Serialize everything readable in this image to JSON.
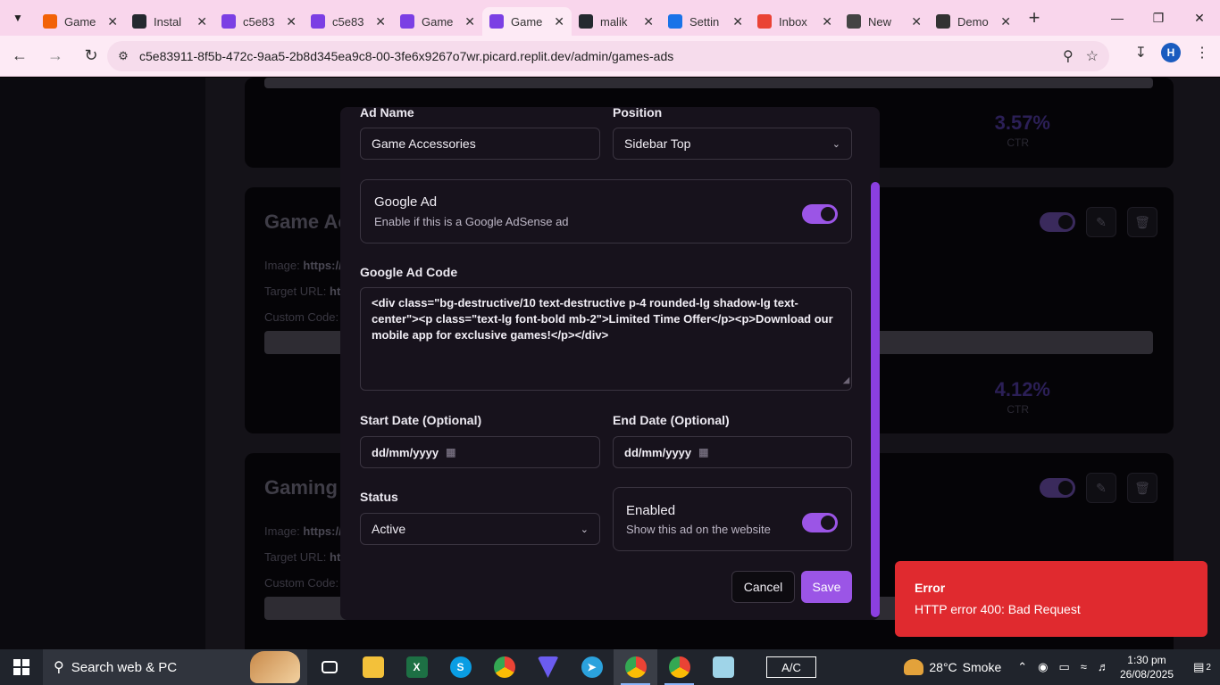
{
  "browser": {
    "tabs": [
      {
        "title": "Game",
        "favicon": "replit-icon",
        "color": "#f26207"
      },
      {
        "title": "Instal",
        "favicon": "github-icon",
        "color": "#24292f"
      },
      {
        "title": "c5e83",
        "favicon": "gamepad-icon",
        "color": "#7b3fe4"
      },
      {
        "title": "c5e83",
        "favicon": "gamepad-icon",
        "color": "#7b3fe4"
      },
      {
        "title": "Game",
        "favicon": "gamepad-icon",
        "color": "#7b3fe4"
      },
      {
        "title": "Game",
        "favicon": "gamepad-icon",
        "color": "#7b3fe4",
        "active": true
      },
      {
        "title": "malik",
        "favicon": "github-icon",
        "color": "#24292f"
      },
      {
        "title": "Settin",
        "favicon": "gear-icon",
        "color": "#1a73e8"
      },
      {
        "title": "Inbox",
        "favicon": "gmail-icon",
        "color": "#ea4335"
      },
      {
        "title": "New",
        "favicon": "chrome-icon",
        "color": "#444444"
      },
      {
        "title": "Demo",
        "favicon": "openai-icon",
        "color": "#333333"
      }
    ],
    "url": "c5e83911-8f5b-472c-9aa5-2b8d345ea9c8-00-3fe6x9267o7wr.picard.replit.dev/admin/games-ads",
    "profile_initial": "H"
  },
  "background_cards": [
    {
      "title": "",
      "ctr": "3.57%",
      "ctr_label": "CTR"
    },
    {
      "title": "Game Ac",
      "image_label": "Image:",
      "image_value": "https://i",
      "target_label": "Target URL:",
      "target_value": "htt",
      "custom_label": "Custom Code:",
      "ctr": "4.12%",
      "ctr_label": "CTR"
    },
    {
      "title": "Gaming (",
      "image_label": "Image:",
      "image_value": "https://i",
      "target_label": "Target URL:",
      "target_value": "htt",
      "custom_label": "Custom Code:"
    }
  ],
  "modal": {
    "ad_name_label": "Ad Name",
    "ad_name_value": "Game Accessories",
    "position_label": "Position",
    "position_value": "Sidebar Top",
    "google_ad_title": "Google Ad",
    "google_ad_desc": "Enable if this is a Google AdSense ad",
    "google_ad_enabled": true,
    "google_code_label": "Google Ad Code",
    "google_code_value": "<div class=\"bg-destructive/10 text-destructive p-4 rounded-lg shadow-lg text-center\"><p class=\"text-lg font-bold mb-2\">Limited Time Offer</p><p>Download our mobile app for exclusive games!</p></div>",
    "start_date_label": "Start Date (Optional)",
    "start_date_value": "dd/mm/yyyy",
    "end_date_label": "End Date (Optional)",
    "end_date_value": "dd/mm/yyyy",
    "status_label": "Status",
    "status_value": "Active",
    "enabled_title": "Enabled",
    "enabled_desc": "Show this ad on the website",
    "enabled": true,
    "cancel_label": "Cancel",
    "save_label": "Save"
  },
  "toast": {
    "title": "Error",
    "message": "HTTP error 400: Bad Request"
  },
  "taskbar": {
    "search_placeholder": "Search web & PC",
    "ac_label": "A/C",
    "weather_temp": "28°C",
    "weather_desc": "Smoke",
    "time": "1:30 pm",
    "date": "26/08/2025",
    "notification_count": "2"
  },
  "colors": {
    "accent": "#9b55e6",
    "error": "#e02a2f",
    "tabstrip": "#f9d6ec"
  }
}
